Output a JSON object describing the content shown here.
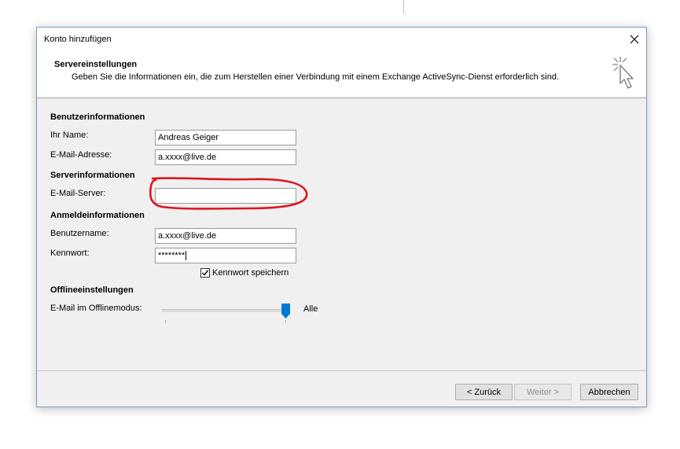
{
  "dialog": {
    "title": "Konto hinzufügen",
    "header_title": "Servereinstellungen",
    "header_description": "Geben Sie die Informationen ein, die zum Herstellen einer Verbindung mit einem Exchange ActiveSync-Dienst erforderlich sind."
  },
  "user_info": {
    "section_title": "Benutzerinformationen",
    "name_label": "Ihr Name:",
    "name_value": "Andreas Geiger",
    "email_label": "E-Mail-Adresse:",
    "email_value": "a.xxxx@live.de"
  },
  "server_info": {
    "section_title": "Serverinformationen",
    "mail_server_label": "E-Mail-Server:",
    "mail_server_value": ""
  },
  "login_info": {
    "section_title": "Anmeldeinformationen",
    "username_label": "Benutzername:",
    "username_value": "a.xxxx@live.de",
    "password_label": "Kennwort:",
    "password_value": "********",
    "remember_label": "Kennwort speichern",
    "remember_checked": true
  },
  "offline": {
    "section_title": "Offlineeinstellungen",
    "mode_label": "E-Mail im Offlinemodus:",
    "mode_value": "Alle",
    "slider_fraction": 1.0
  },
  "footer": {
    "back_label": "< Zurück",
    "next_label": "Weiter >",
    "cancel_label": "Abbrechen"
  },
  "colors": {
    "accent": "#0078d7",
    "annotation": "#d9161f"
  },
  "icons": [
    "close-icon",
    "wizard-cursor-icon",
    "checkmark-icon",
    "slider-thumb"
  ]
}
